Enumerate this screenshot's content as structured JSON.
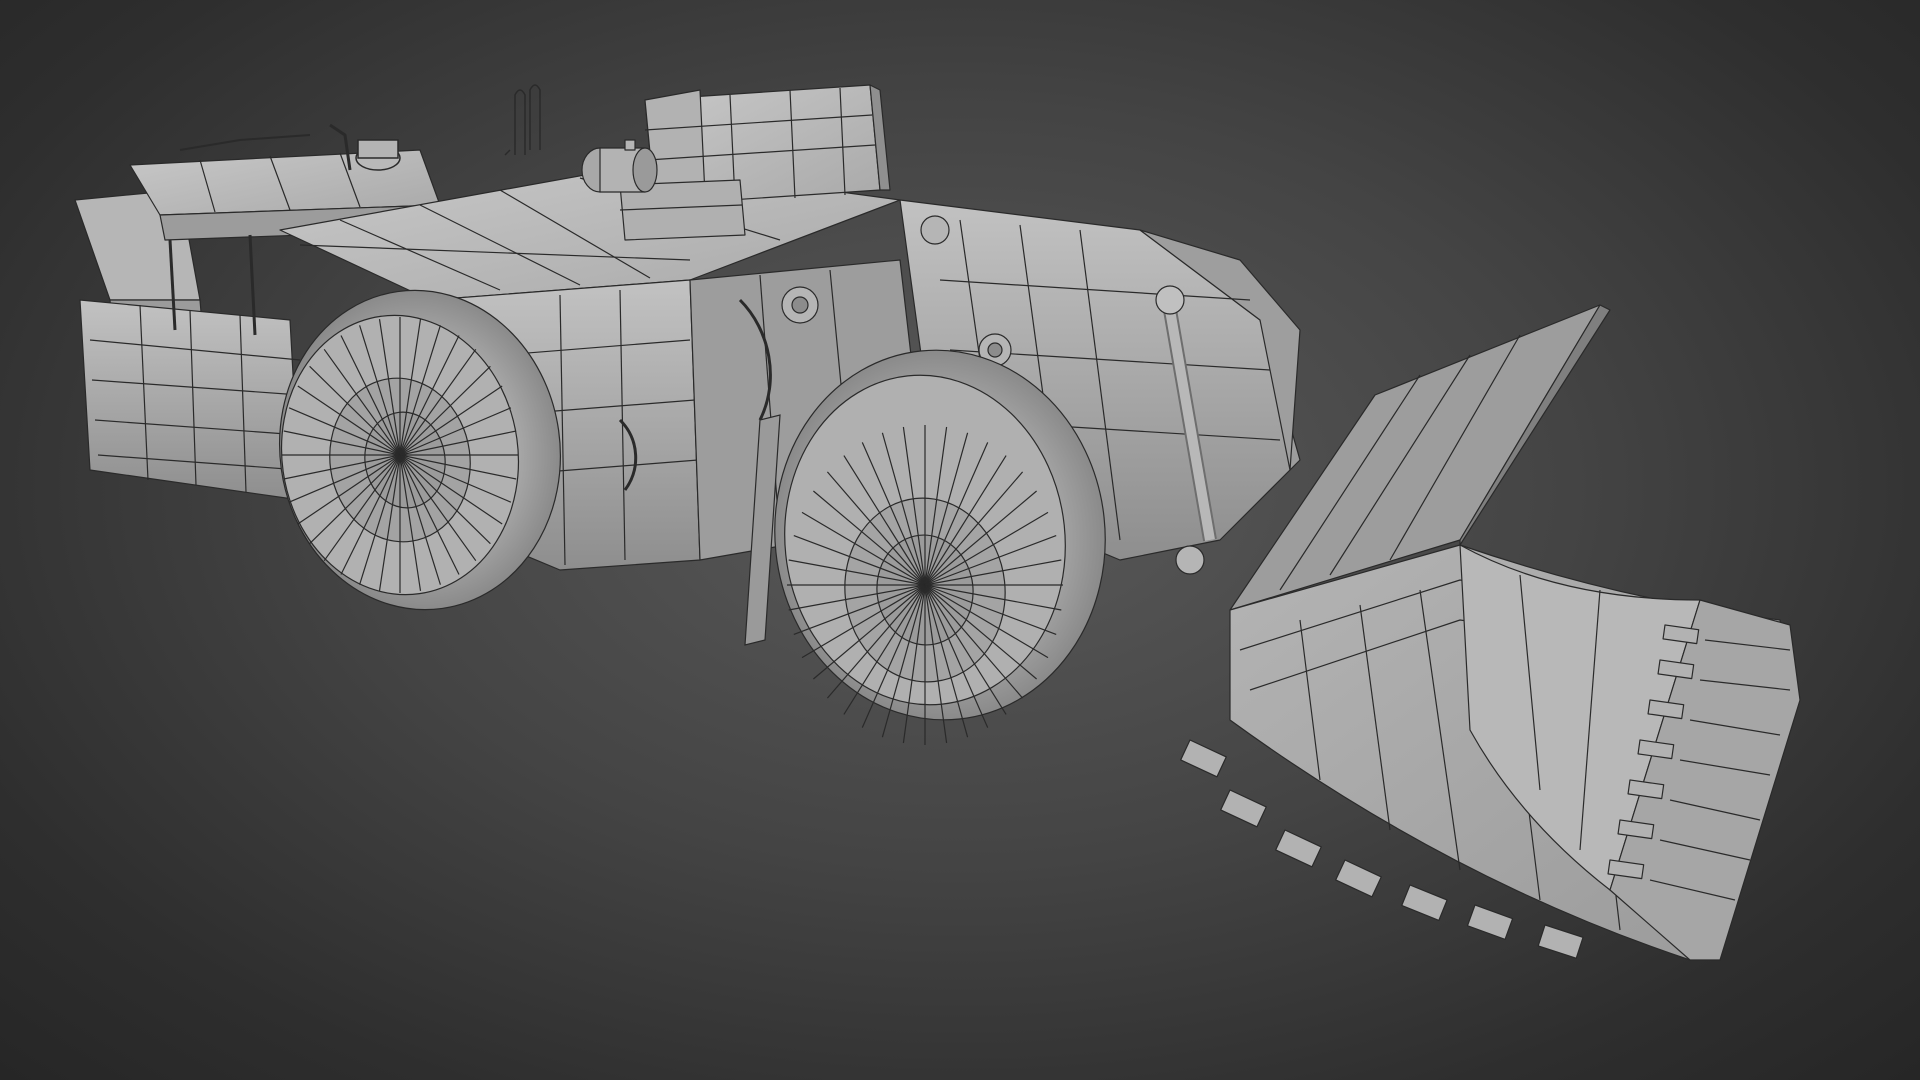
{
  "scene": {
    "subject": "underground-loader-wireframe-model",
    "colors": {
      "background_center": "#5a5a5a",
      "background_edge": "#262626",
      "surface": "#a8a8a8",
      "surface_light": "#bdbdbd",
      "surface_dark": "#7d7d7d",
      "wire": "#2a2a2a"
    },
    "icons": [
      "rear-wheel-icon",
      "front-wheel-icon",
      "bucket-icon",
      "cab-icon",
      "engine-block-icon",
      "exhaust-stack-icon"
    ]
  }
}
